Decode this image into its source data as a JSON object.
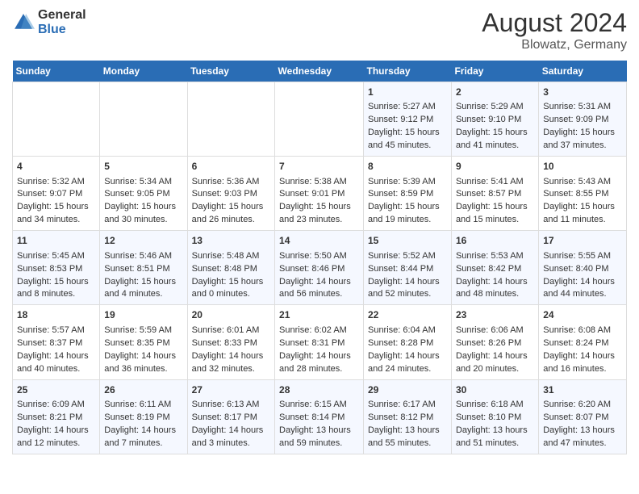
{
  "header": {
    "logo_line1": "General",
    "logo_line2": "Blue",
    "month_year": "August 2024",
    "location": "Blowatz, Germany"
  },
  "days_of_week": [
    "Sunday",
    "Monday",
    "Tuesday",
    "Wednesday",
    "Thursday",
    "Friday",
    "Saturday"
  ],
  "weeks": [
    [
      {
        "day": "",
        "content": ""
      },
      {
        "day": "",
        "content": ""
      },
      {
        "day": "",
        "content": ""
      },
      {
        "day": "",
        "content": ""
      },
      {
        "day": "1",
        "content": "Sunrise: 5:27 AM\nSunset: 9:12 PM\nDaylight: 15 hours and 45 minutes."
      },
      {
        "day": "2",
        "content": "Sunrise: 5:29 AM\nSunset: 9:10 PM\nDaylight: 15 hours and 41 minutes."
      },
      {
        "day": "3",
        "content": "Sunrise: 5:31 AM\nSunset: 9:09 PM\nDaylight: 15 hours and 37 minutes."
      }
    ],
    [
      {
        "day": "4",
        "content": "Sunrise: 5:32 AM\nSunset: 9:07 PM\nDaylight: 15 hours and 34 minutes."
      },
      {
        "day": "5",
        "content": "Sunrise: 5:34 AM\nSunset: 9:05 PM\nDaylight: 15 hours and 30 minutes."
      },
      {
        "day": "6",
        "content": "Sunrise: 5:36 AM\nSunset: 9:03 PM\nDaylight: 15 hours and 26 minutes."
      },
      {
        "day": "7",
        "content": "Sunrise: 5:38 AM\nSunset: 9:01 PM\nDaylight: 15 hours and 23 minutes."
      },
      {
        "day": "8",
        "content": "Sunrise: 5:39 AM\nSunset: 8:59 PM\nDaylight: 15 hours and 19 minutes."
      },
      {
        "day": "9",
        "content": "Sunrise: 5:41 AM\nSunset: 8:57 PM\nDaylight: 15 hours and 15 minutes."
      },
      {
        "day": "10",
        "content": "Sunrise: 5:43 AM\nSunset: 8:55 PM\nDaylight: 15 hours and 11 minutes."
      }
    ],
    [
      {
        "day": "11",
        "content": "Sunrise: 5:45 AM\nSunset: 8:53 PM\nDaylight: 15 hours and 8 minutes."
      },
      {
        "day": "12",
        "content": "Sunrise: 5:46 AM\nSunset: 8:51 PM\nDaylight: 15 hours and 4 minutes."
      },
      {
        "day": "13",
        "content": "Sunrise: 5:48 AM\nSunset: 8:48 PM\nDaylight: 15 hours and 0 minutes."
      },
      {
        "day": "14",
        "content": "Sunrise: 5:50 AM\nSunset: 8:46 PM\nDaylight: 14 hours and 56 minutes."
      },
      {
        "day": "15",
        "content": "Sunrise: 5:52 AM\nSunset: 8:44 PM\nDaylight: 14 hours and 52 minutes."
      },
      {
        "day": "16",
        "content": "Sunrise: 5:53 AM\nSunset: 8:42 PM\nDaylight: 14 hours and 48 minutes."
      },
      {
        "day": "17",
        "content": "Sunrise: 5:55 AM\nSunset: 8:40 PM\nDaylight: 14 hours and 44 minutes."
      }
    ],
    [
      {
        "day": "18",
        "content": "Sunrise: 5:57 AM\nSunset: 8:37 PM\nDaylight: 14 hours and 40 minutes."
      },
      {
        "day": "19",
        "content": "Sunrise: 5:59 AM\nSunset: 8:35 PM\nDaylight: 14 hours and 36 minutes."
      },
      {
        "day": "20",
        "content": "Sunrise: 6:01 AM\nSunset: 8:33 PM\nDaylight: 14 hours and 32 minutes."
      },
      {
        "day": "21",
        "content": "Sunrise: 6:02 AM\nSunset: 8:31 PM\nDaylight: 14 hours and 28 minutes."
      },
      {
        "day": "22",
        "content": "Sunrise: 6:04 AM\nSunset: 8:28 PM\nDaylight: 14 hours and 24 minutes."
      },
      {
        "day": "23",
        "content": "Sunrise: 6:06 AM\nSunset: 8:26 PM\nDaylight: 14 hours and 20 minutes."
      },
      {
        "day": "24",
        "content": "Sunrise: 6:08 AM\nSunset: 8:24 PM\nDaylight: 14 hours and 16 minutes."
      }
    ],
    [
      {
        "day": "25",
        "content": "Sunrise: 6:09 AM\nSunset: 8:21 PM\nDaylight: 14 hours and 12 minutes."
      },
      {
        "day": "26",
        "content": "Sunrise: 6:11 AM\nSunset: 8:19 PM\nDaylight: 14 hours and 7 minutes."
      },
      {
        "day": "27",
        "content": "Sunrise: 6:13 AM\nSunset: 8:17 PM\nDaylight: 14 hours and 3 minutes."
      },
      {
        "day": "28",
        "content": "Sunrise: 6:15 AM\nSunset: 8:14 PM\nDaylight: 13 hours and 59 minutes."
      },
      {
        "day": "29",
        "content": "Sunrise: 6:17 AM\nSunset: 8:12 PM\nDaylight: 13 hours and 55 minutes."
      },
      {
        "day": "30",
        "content": "Sunrise: 6:18 AM\nSunset: 8:10 PM\nDaylight: 13 hours and 51 minutes."
      },
      {
        "day": "31",
        "content": "Sunrise: 6:20 AM\nSunset: 8:07 PM\nDaylight: 13 hours and 47 minutes."
      }
    ]
  ]
}
